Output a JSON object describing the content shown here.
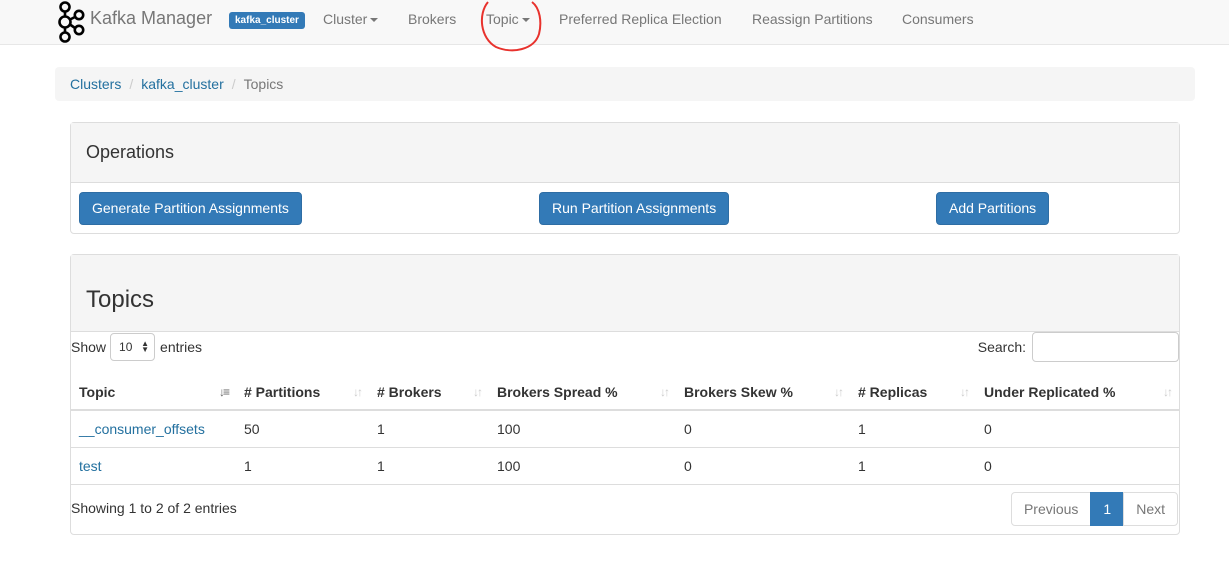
{
  "navbar": {
    "brand": "Kafka Manager",
    "cluster_label": "kafka_cluster",
    "items": [
      "Cluster",
      "Brokers",
      "Topic",
      "Preferred Replica Election",
      "Reassign Partitions",
      "Consumers"
    ]
  },
  "breadcrumb": [
    "Clusters",
    "kafka_cluster",
    "Topics"
  ],
  "operations": {
    "title": "Operations",
    "buttons": [
      "Generate Partition Assignments",
      "Run Partition Assignments",
      "Add Partitions"
    ]
  },
  "topics": {
    "title": "Topics",
    "show_label": "Show",
    "entries_label": "entries",
    "page_length": "10",
    "search_label": "Search:",
    "columns": [
      "Topic",
      "# Partitions",
      "# Brokers",
      "Brokers Spread %",
      "Brokers Skew %",
      "# Replicas",
      "Under Replicated %"
    ],
    "rows": [
      [
        "__consumer_offsets",
        "50",
        "1",
        "100",
        "0",
        "1",
        "0"
      ],
      [
        "test",
        "1",
        "1",
        "100",
        "0",
        "1",
        "0"
      ]
    ],
    "info": "Showing 1 to 2 of 2 entries",
    "pagination": {
      "previous": "Previous",
      "current": "1",
      "next": "Next"
    }
  },
  "colors": {
    "primary": "#337ab7",
    "link": "#23709f",
    "annotation": "#e8322d"
  },
  "icons": {
    "brand": "kafka-logo-icon",
    "sort": "sort-icon",
    "sort_active": "sort-alpha-desc-icon"
  }
}
